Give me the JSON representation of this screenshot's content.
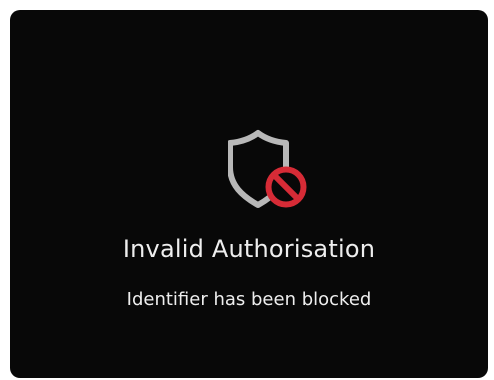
{
  "message": {
    "title": "Invalid Authorisation",
    "subtitle": "Identifier has been blocked"
  },
  "icons": {
    "status_icon": "shield-blocked-icon"
  },
  "colors": {
    "background": "#080808",
    "text": "#eeeeee",
    "shield": "#b8b8b8",
    "blocked": "#d62b36"
  }
}
